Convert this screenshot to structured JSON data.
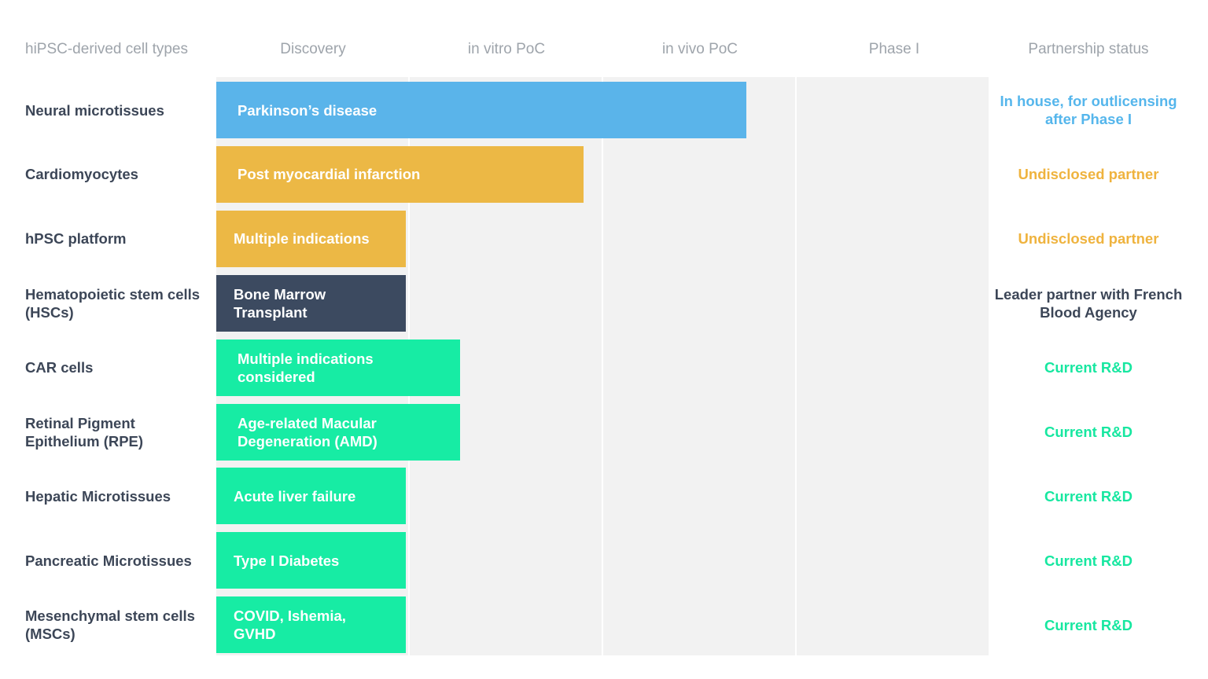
{
  "chart_data": {
    "type": "table",
    "columns": [
      "hiPSC-derived cell types",
      "Discovery",
      "in vitro PoC",
      "in vivo PoC",
      "Phase I",
      "Partnership status"
    ],
    "stages": [
      "Discovery",
      "in vitro PoC",
      "in vivo PoC",
      "Phase I"
    ],
    "colors": {
      "blue": "#5ab4ea",
      "yellow": "#ecb845",
      "navy": "#3c4a60",
      "green": "#17eca4",
      "status_blue": "#55b6ec",
      "status_yellow": "#efb33e",
      "status_navy": "#3c4657",
      "status_green": "#17e7a0"
    },
    "rows": [
      {
        "cell_type": "Neural microtissues",
        "indication": "Parkinson’s disease",
        "progress": 2.74,
        "bar_color": "#5ab4ea",
        "status": "In house, for outlicensing after Phase I",
        "status_color": "#55b6ec"
      },
      {
        "cell_type": "Cardiomyocytes",
        "indication": "Post myocardial infarction",
        "progress": 1.9,
        "bar_color": "#ecb845",
        "status": "Undisclosed partner",
        "status_color": "#efb33e"
      },
      {
        "cell_type": "hPSC platform",
        "indication": "Multiple indications",
        "progress": 0.98,
        "bar_color": "#ecb845",
        "status": "Undisclosed partner",
        "status_color": "#efb33e"
      },
      {
        "cell_type": "Hematopoietic stem cells (HSCs)",
        "indication": "Bone Marrow Transplant",
        "progress": 0.98,
        "bar_color": "#3c4a60",
        "status": "Leader partner with French Blood Agency",
        "status_color": "#3c4657"
      },
      {
        "cell_type": "CAR cells",
        "indication": "Multiple indications considered",
        "progress": 1.26,
        "bar_color": "#17eca4",
        "status": "Current R&D",
        "status_color": "#17e7a0"
      },
      {
        "cell_type": "Retinal Pigment Epithelium (RPE)",
        "indication": "Age-related Macular Degeneration (AMD)",
        "progress": 1.26,
        "bar_color": "#17eca4",
        "status": "Current R&D",
        "status_color": "#17e7a0"
      },
      {
        "cell_type": "Hepatic Microtissues",
        "indication": "Acute liver failure",
        "progress": 0.98,
        "bar_color": "#17eca4",
        "status": "Current R&D",
        "status_color": "#17e7a0"
      },
      {
        "cell_type": "Pancreatic Microtissues",
        "indication": "Type I Diabetes",
        "progress": 0.98,
        "bar_color": "#17eca4",
        "status": "Current R&D",
        "status_color": "#17e7a0"
      },
      {
        "cell_type": "Mesenchymal stem cells (MSCs)",
        "indication": "COVID, Ishemia, GVHD",
        "progress": 0.98,
        "bar_color": "#17eca4",
        "status": "Current R&D",
        "status_color": "#17e7a0"
      }
    ]
  }
}
